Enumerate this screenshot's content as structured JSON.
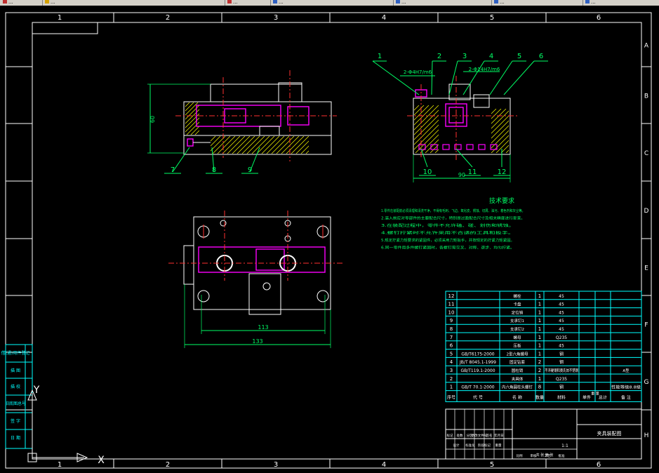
{
  "tabs": [
    {
      "label": "...",
      "color": "#c03030"
    },
    {
      "label": "...",
      "color": "#d4a000"
    },
    {
      "label": "...",
      "color": "#c03030"
    },
    {
      "label": "...",
      "color": "#3060c0"
    },
    {
      "label": "...",
      "color": "#3060c0"
    },
    {
      "label": "...",
      "color": "#3060c0"
    },
    {
      "label": "...",
      "color": "#3060c0"
    }
  ],
  "colors": {
    "background": "#000000",
    "frame": "#ffffff",
    "geometry": "#ffffff",
    "section": "#ff00ff",
    "center": "#ff3030",
    "dimension": "#00ff66",
    "titleblock": "#00ffff",
    "tabbar": "#d4d0c8"
  },
  "grid": {
    "columns": [
      "1",
      "2",
      "3",
      "4",
      "5",
      "6"
    ],
    "rows": [
      "A",
      "B",
      "C",
      "D",
      "E",
      "F",
      "G",
      "H"
    ]
  },
  "side_labels": [
    "借(通)用件登记",
    "描 图",
    "描 校",
    "旧底图总号",
    "签 字",
    "日 期"
  ],
  "balloons_front": [
    "7",
    "8",
    "9"
  ],
  "balloons_side_top": [
    "1",
    "2",
    "3",
    "4",
    "5",
    "6"
  ],
  "balloons_side_bottom": [
    "10",
    "11",
    "12"
  ],
  "dims": {
    "front_height": "60",
    "side_fit_1": "2-Φ4H7/m6",
    "side_fit_2": "2-Φ14H7/m6",
    "side_width": "90",
    "top_inner": "113",
    "top_outer": "133"
  },
  "tech": {
    "title": "技术要求",
    "lines": [
      "1.零件在装配前必须清理和清洗干净，不得有毛刺、飞边、氧化皮、锈蚀、切屑、油污、着色剂和灰尘等。",
      "2.装入前应对零部件的主要配合尺寸，特别是过盈配合尺寸及相关精度进行复查。",
      "3.在装配过程中，零件不允许磕、碰、划伤和锈蚀。",
      "4.螺钉拧紧时不允许采用不合适的工具和扳手。",
      "5.规定拧紧力矩要求的紧固件，必须采用力矩扳手，并按规定的拧紧力矩紧固。",
      "6.同一零件用多件螺钉紧固时，各螺钉需交叉、对称、逐步、均匀拧紧。"
    ]
  },
  "bom": {
    "rows": [
      {
        "no": "12",
        "code": "",
        "name": "螺栓",
        "qty": "1",
        "mat": "45",
        "note": ""
      },
      {
        "no": "11",
        "code": "",
        "name": "卡盘",
        "qty": "1",
        "mat": "45",
        "note": ""
      },
      {
        "no": "10",
        "code": "",
        "name": "定位销",
        "qty": "1",
        "mat": "45",
        "note": ""
      },
      {
        "no": "9",
        "code": "",
        "name": "支承钉1",
        "qty": "1",
        "mat": "45",
        "note": ""
      },
      {
        "no": "8",
        "code": "",
        "name": "支承钉2",
        "qty": "1",
        "mat": "45",
        "note": ""
      },
      {
        "no": "7",
        "code": "",
        "name": "螺母",
        "qty": "1",
        "mat": "Q235",
        "note": ""
      },
      {
        "no": "6",
        "code": "",
        "name": "压板",
        "qty": "1",
        "mat": "45",
        "note": ""
      },
      {
        "no": "5",
        "code": "GB/T6175-2000",
        "name": "2型六角螺母",
        "qty": "1",
        "mat": "钢",
        "note": ""
      },
      {
        "no": "4",
        "code": "JB/T 8045.1-1999",
        "name": "固定钻套",
        "qty": "2",
        "mat": "钢",
        "note": ""
      },
      {
        "no": "3",
        "code": "GB/T119.1-2000",
        "name": "圆柱销",
        "qty": "2",
        "mat": "不淬硬钢和奥氏体不锈钢",
        "note": "A型"
      },
      {
        "no": "2",
        "code": "",
        "name": "夹具体",
        "qty": "1",
        "mat": "Q235",
        "note": ""
      },
      {
        "no": "1",
        "code": "GB/T 70.1-2000",
        "name": "内六角圆柱头螺钉",
        "qty": "8",
        "mat": "钢",
        "note": "性能等级8.8级"
      }
    ],
    "header": [
      "序号",
      "代 号",
      "名 称",
      "数量",
      "材料",
      "单件",
      "总计",
      "备 注"
    ],
    "header_sub": "重 量"
  },
  "title_block": {
    "drawing_name": "夹具装配图",
    "scale": "1:1",
    "sheet": "共 张 第 张",
    "labels": [
      "标记",
      "处数",
      "分区",
      "更改文件号",
      "签名",
      "年月日"
    ],
    "labels2": [
      "设计",
      "标准化",
      "阶段标记",
      "重量",
      "比例",
      "审核",
      "工艺",
      "批准"
    ]
  },
  "ucs": {
    "x": "X",
    "y": "Y"
  }
}
